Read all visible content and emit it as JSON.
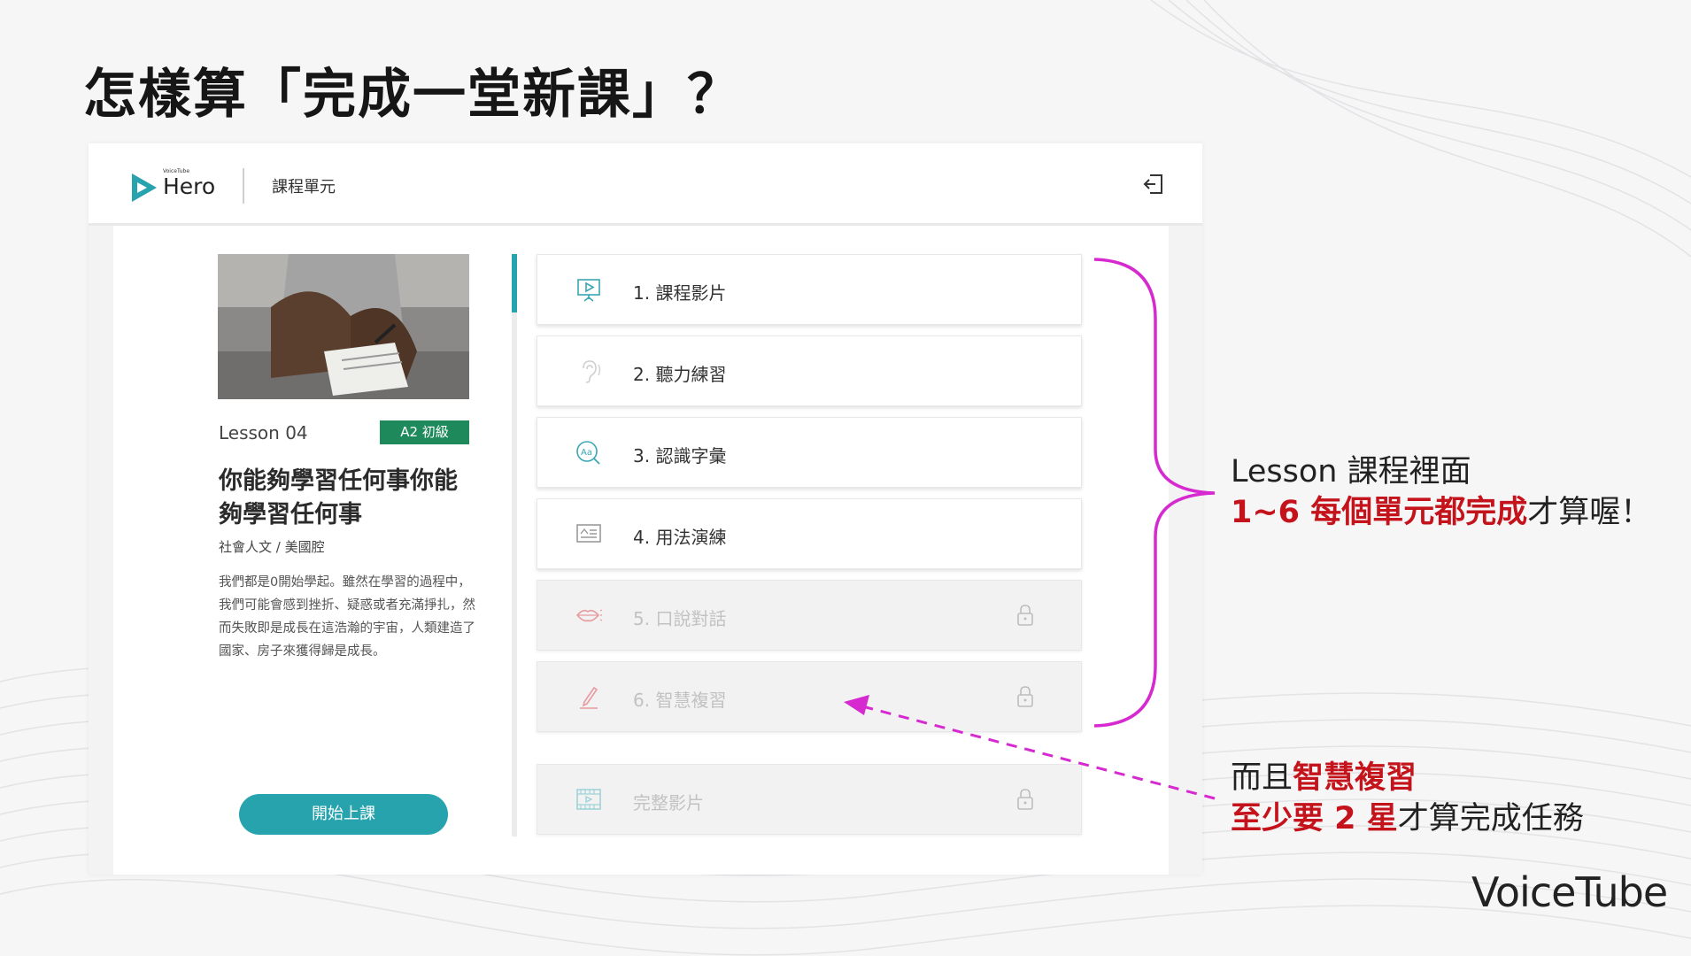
{
  "slide": {
    "title": "怎樣算「完成一堂新課」？"
  },
  "app": {
    "logo_small": "VoiceTube",
    "logo_text": "Hero",
    "header_title": "課程單元"
  },
  "lesson": {
    "number": "Lesson 04",
    "level": "A2 初級",
    "title": "你能夠學習任何事你能夠學習任何事",
    "category": "社會人文 / 美國腔",
    "description": "我們都是0開始學起。雖然在學習的過程中，我們可能會感到挫折、疑惑或者充滿掙扎，然而失敗即是成長在這浩瀚的宇宙，人類建造了國家、房子來獲得歸是成長。",
    "start_button": "開始上課",
    "progress_fraction": 0.1
  },
  "units": [
    {
      "label": "1. 課程影片",
      "icon": "presentation-video-icon",
      "locked": false
    },
    {
      "label": "2. 聽力練習",
      "icon": "ear-icon",
      "locked": false
    },
    {
      "label": "3. 認識字彙",
      "icon": "vocabulary-icon",
      "locked": false
    },
    {
      "label": "4. 用法演練",
      "icon": "usage-card-icon",
      "locked": false
    },
    {
      "label": "5. 口說對話",
      "icon": "lips-icon",
      "locked": true
    },
    {
      "label": "6. 智慧複習",
      "icon": "pencil-icon",
      "locked": true
    },
    {
      "label": "完整影片",
      "icon": "film-icon",
      "locked": true
    }
  ],
  "annotations": {
    "note1_line1": "Lesson 課程裡面",
    "note1_highlight": "1~6 每個單元都完成",
    "note1_rest": "才算喔！",
    "note2_prefix": "而且",
    "note2_highlight1": "智慧複習",
    "note2_highlight2": "至少要 2 星",
    "note2_rest": "才算完成任務"
  },
  "brand": {
    "name": "VoiceTube"
  },
  "colors": {
    "teal": "#27a3ae",
    "badge_green": "#1e8a5c",
    "annotation_magenta": "#d62ad0",
    "highlight_red": "#c4131b"
  }
}
